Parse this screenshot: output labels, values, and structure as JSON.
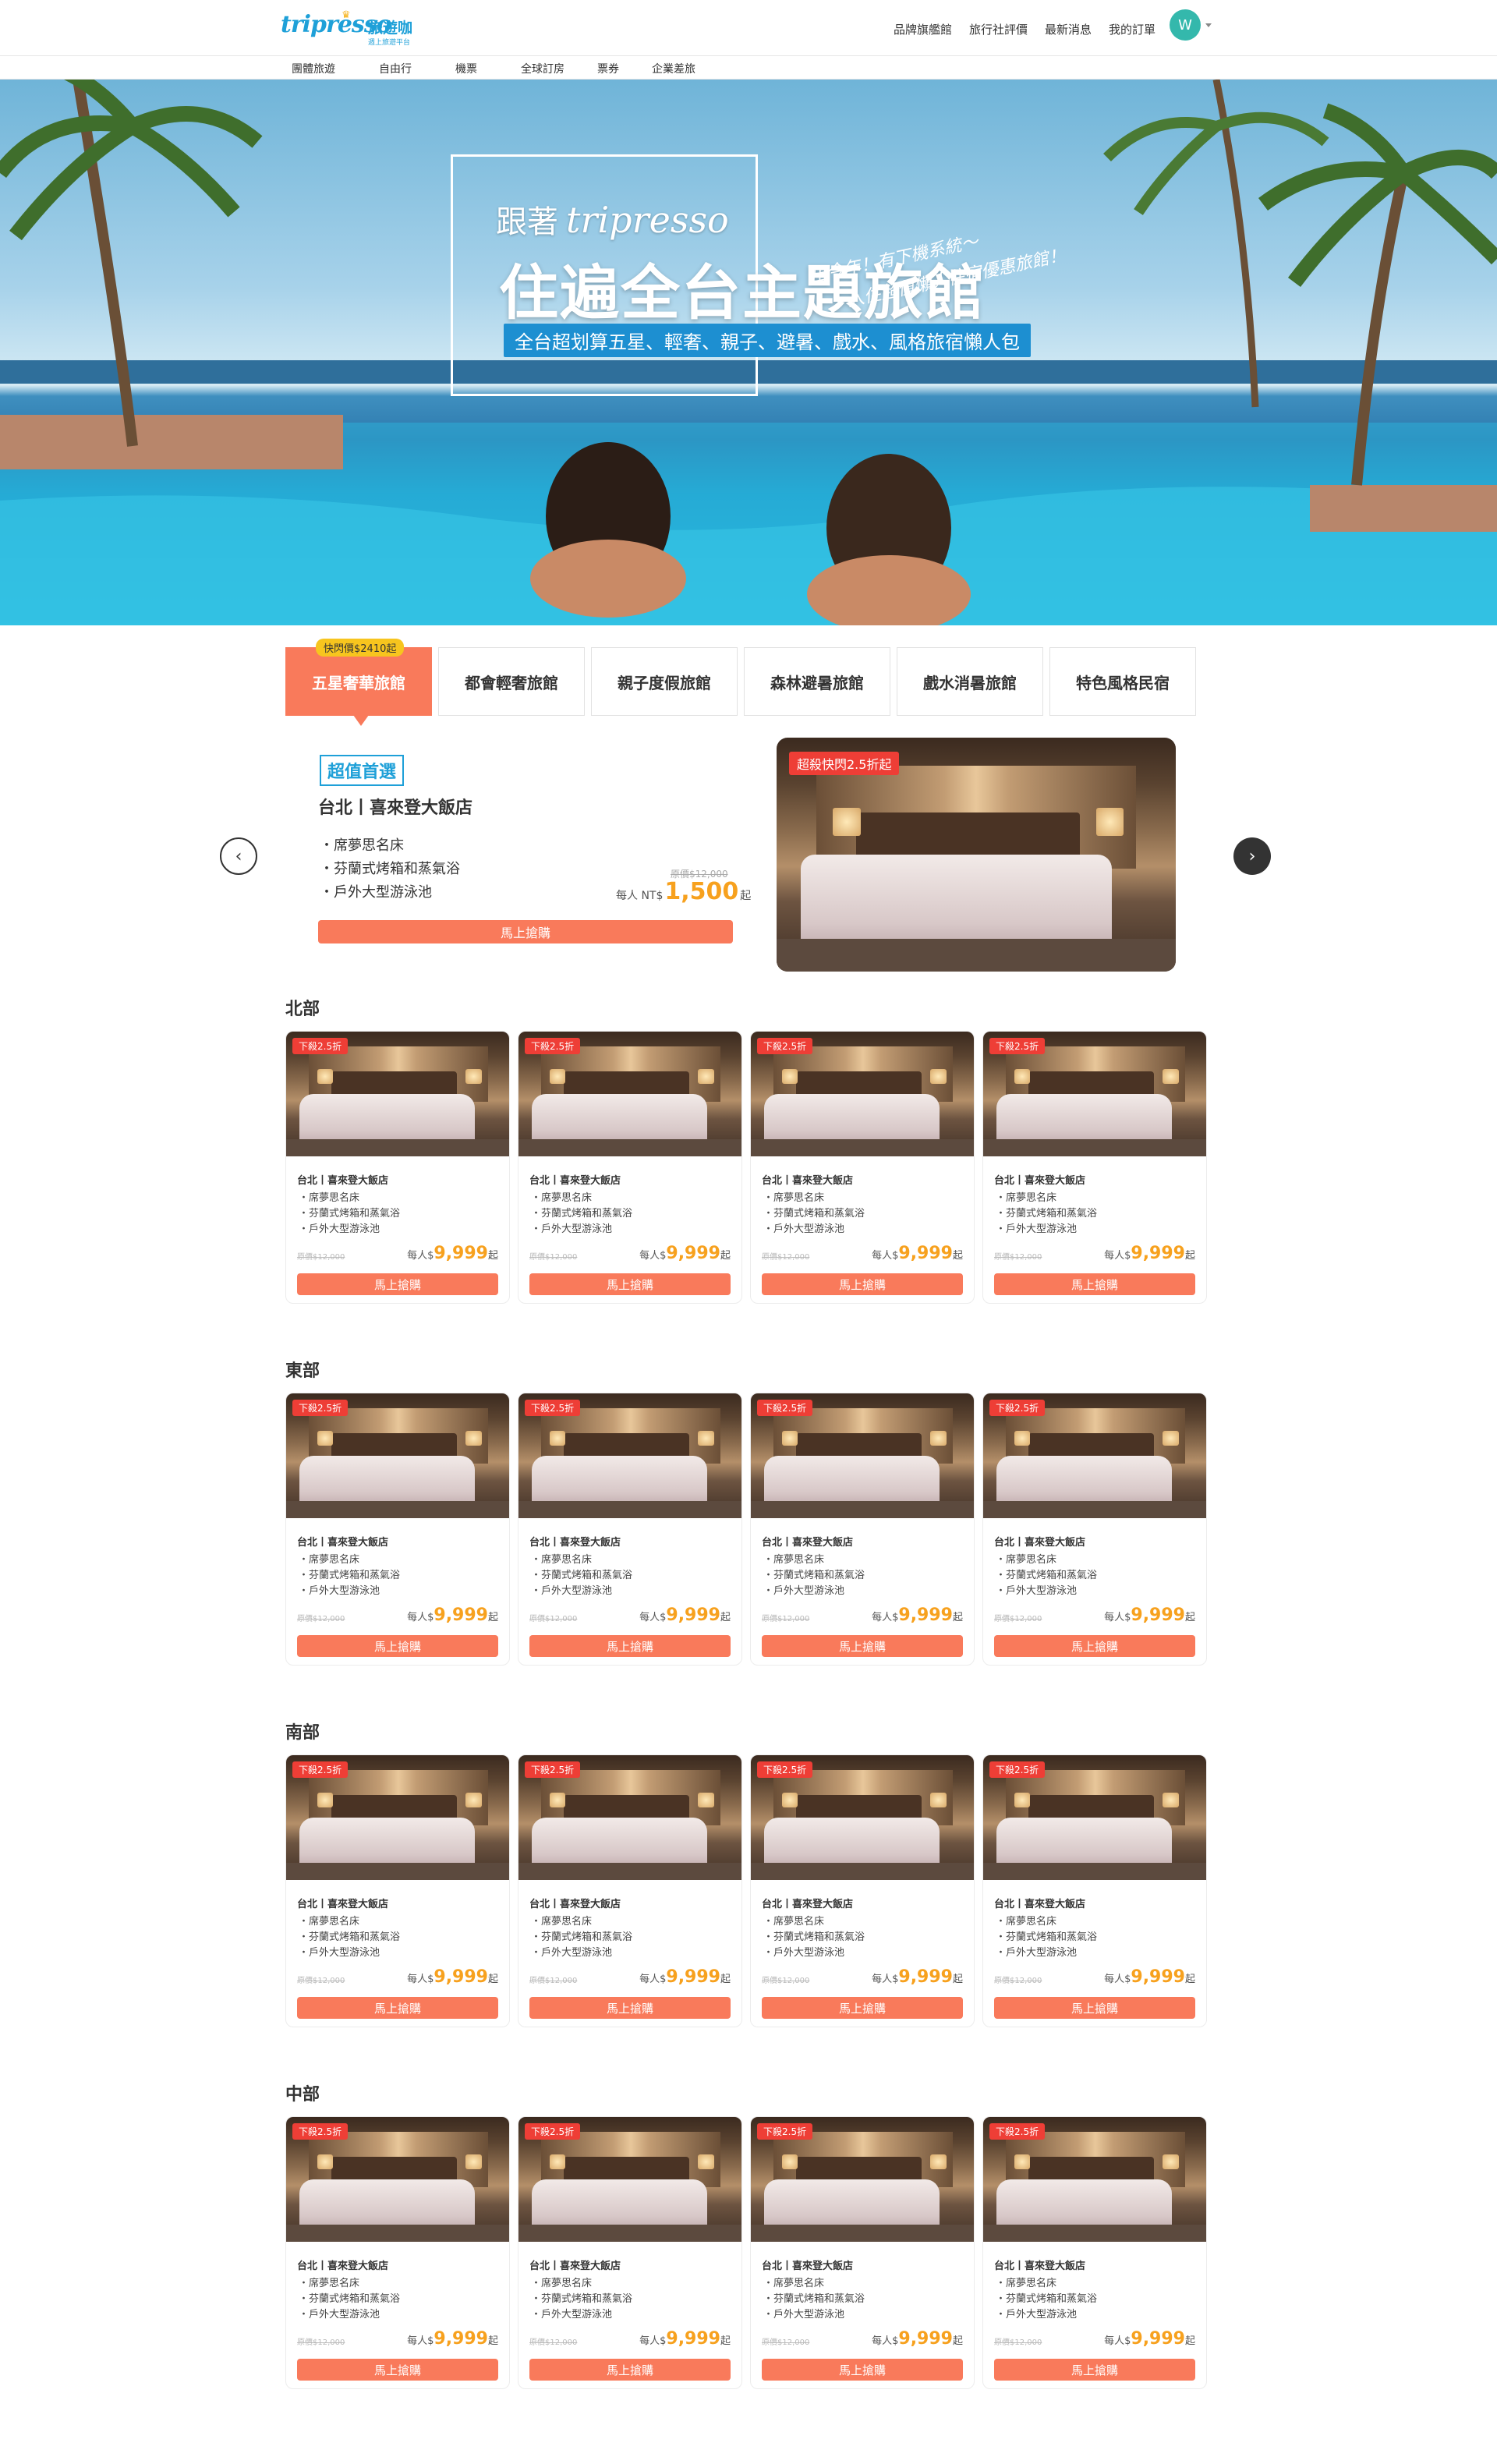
{
  "brand": {
    "logo_word": "tripresso",
    "logo_cn": "旅遊咖",
    "logo_tag": "週上旅遊平台"
  },
  "topnav": {
    "items": [
      "品牌旗艦館",
      "旅行社評價",
      "最新消息",
      "我的訂單"
    ],
    "avatar": "W"
  },
  "subnav": {
    "items": [
      "團體旅遊",
      "自由行",
      "機票",
      "全球訂房",
      "票券",
      "企業差旅"
    ]
  },
  "hero": {
    "line1": "跟著",
    "brand": "tripresso",
    "title": "住遍全台主題旅館",
    "subtitle": "全台超划算五星、輕奢、親子、避暑、戲水、風格旅宿懶人包",
    "script1": "出今年！有下機系統～",
    "script2": "入住超值懶人住宿優惠旅館！"
  },
  "tabs": [
    {
      "label": "五星奢華旅館",
      "badge": "快閃價$2410起",
      "active": true
    },
    {
      "label": "都會輕奢旅館"
    },
    {
      "label": "親子度假旅館"
    },
    {
      "label": "森林避暑旅館"
    },
    {
      "label": "戲水消暑旅館"
    },
    {
      "label": "特色風格民宿"
    }
  ],
  "featured": {
    "tag": "超值首選",
    "name": "台北丨喜來登大飯店",
    "features": [
      "席夢思名床",
      "芬蘭式烤箱和蒸氣浴",
      "戶外大型游泳池"
    ],
    "orig_price": "原價$12,000",
    "price_prefix": "每人 NT$",
    "price": "1,500",
    "price_suffix": "起",
    "button": "馬上搶購",
    "flash_badge": "超殺快閃2.5折起"
  },
  "card_template": {
    "discount": "下殺2.5折",
    "name": "台北丨喜來登大飯店",
    "features": [
      "席夢思名床",
      "芬蘭式烤箱和蒸氣浴",
      "戶外大型游泳池"
    ],
    "orig_price": "原價$12,000",
    "price_prefix": "每人$",
    "price": "9,999",
    "price_suffix": "起",
    "button": "馬上搶購"
  },
  "sections": [
    {
      "title": "北部"
    },
    {
      "title": "東部"
    },
    {
      "title": "南部"
    },
    {
      "title": "中部"
    }
  ],
  "colors": {
    "accent": "#f97a5b",
    "price": "#f7a11e",
    "brand": "#1ea0d8",
    "flash": "#ee3e36",
    "badge": "#f7c51e"
  }
}
